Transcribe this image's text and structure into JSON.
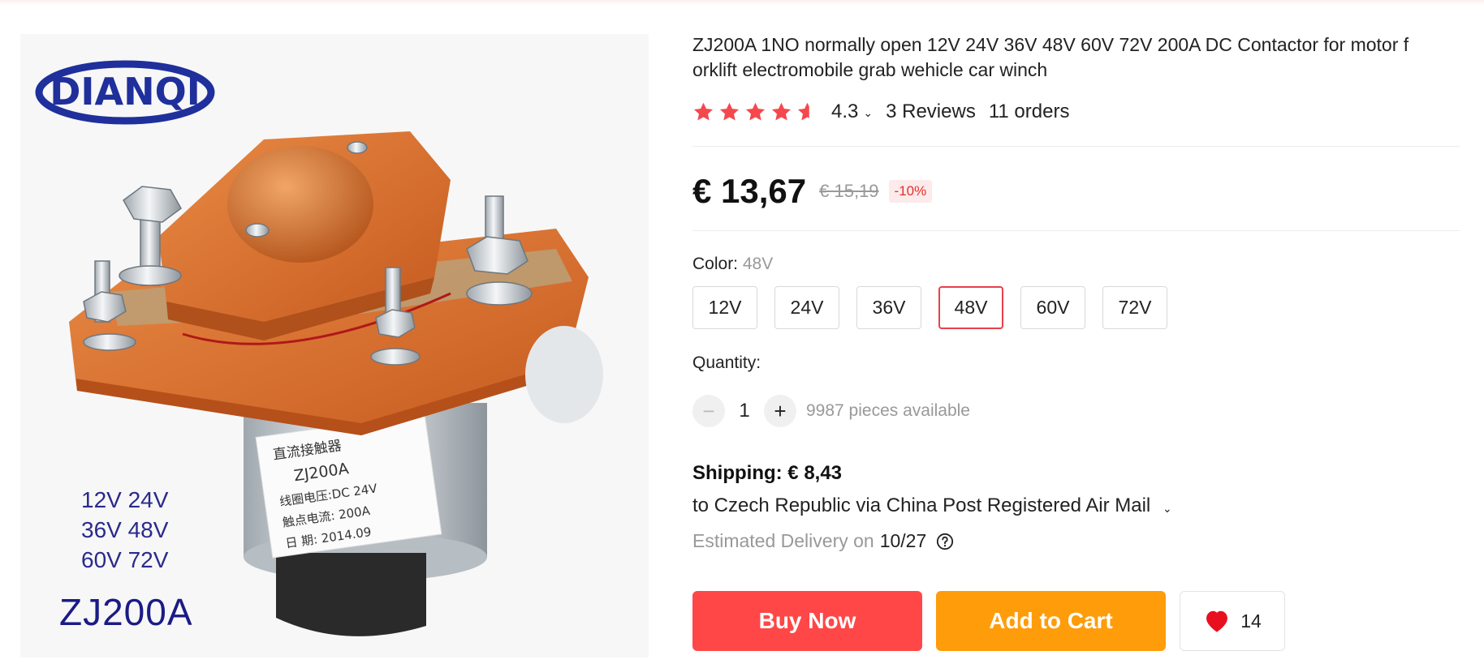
{
  "product": {
    "title": "ZJ200A 1NO normally open 12V 24V 36V 48V 60V 72V 200A DC Contactor for motor f orklift electromobile grab wehicle car winch",
    "image": {
      "brand_logo": "DIANQI",
      "label_lines": [
        "直流接触器",
        "ZJ200A",
        "线圈电压:DC 24V",
        "触点电流: 200A",
        "日   期: 2014.09"
      ],
      "voltage_lines": [
        "12V 24V",
        "36V 48V",
        "60V 72V"
      ],
      "model": "ZJ200A"
    }
  },
  "rating": {
    "stars": 4.5,
    "value": "4.3",
    "reviews": "3 Reviews",
    "orders": "11 orders",
    "star_color": "#f5484d"
  },
  "price": {
    "current": "€ 13,67",
    "original": "€ 15,19",
    "discount": "-10%"
  },
  "color": {
    "label": "Color:",
    "selected": "48V",
    "options": [
      "12V",
      "24V",
      "36V",
      "48V",
      "60V",
      "72V"
    ],
    "selected_border_color": "#e8404a"
  },
  "quantity": {
    "label": "Quantity:",
    "value": "1",
    "minus_symbol": "−",
    "plus_symbol": "+",
    "available": "9987 pieces available"
  },
  "shipping": {
    "title": "Shipping: € 8,43",
    "route": "to Czech Republic via China Post Registered Air Mail",
    "delivery_label": "Estimated Delivery on",
    "delivery_date": "10/27"
  },
  "actions": {
    "buy_now": "Buy Now",
    "add_to_cart": "Add to Cart",
    "wishlist_count": "14",
    "buy_color": "#ff4747",
    "cart_color": "#ff9c0a",
    "heart_icon": "heart-icon"
  }
}
